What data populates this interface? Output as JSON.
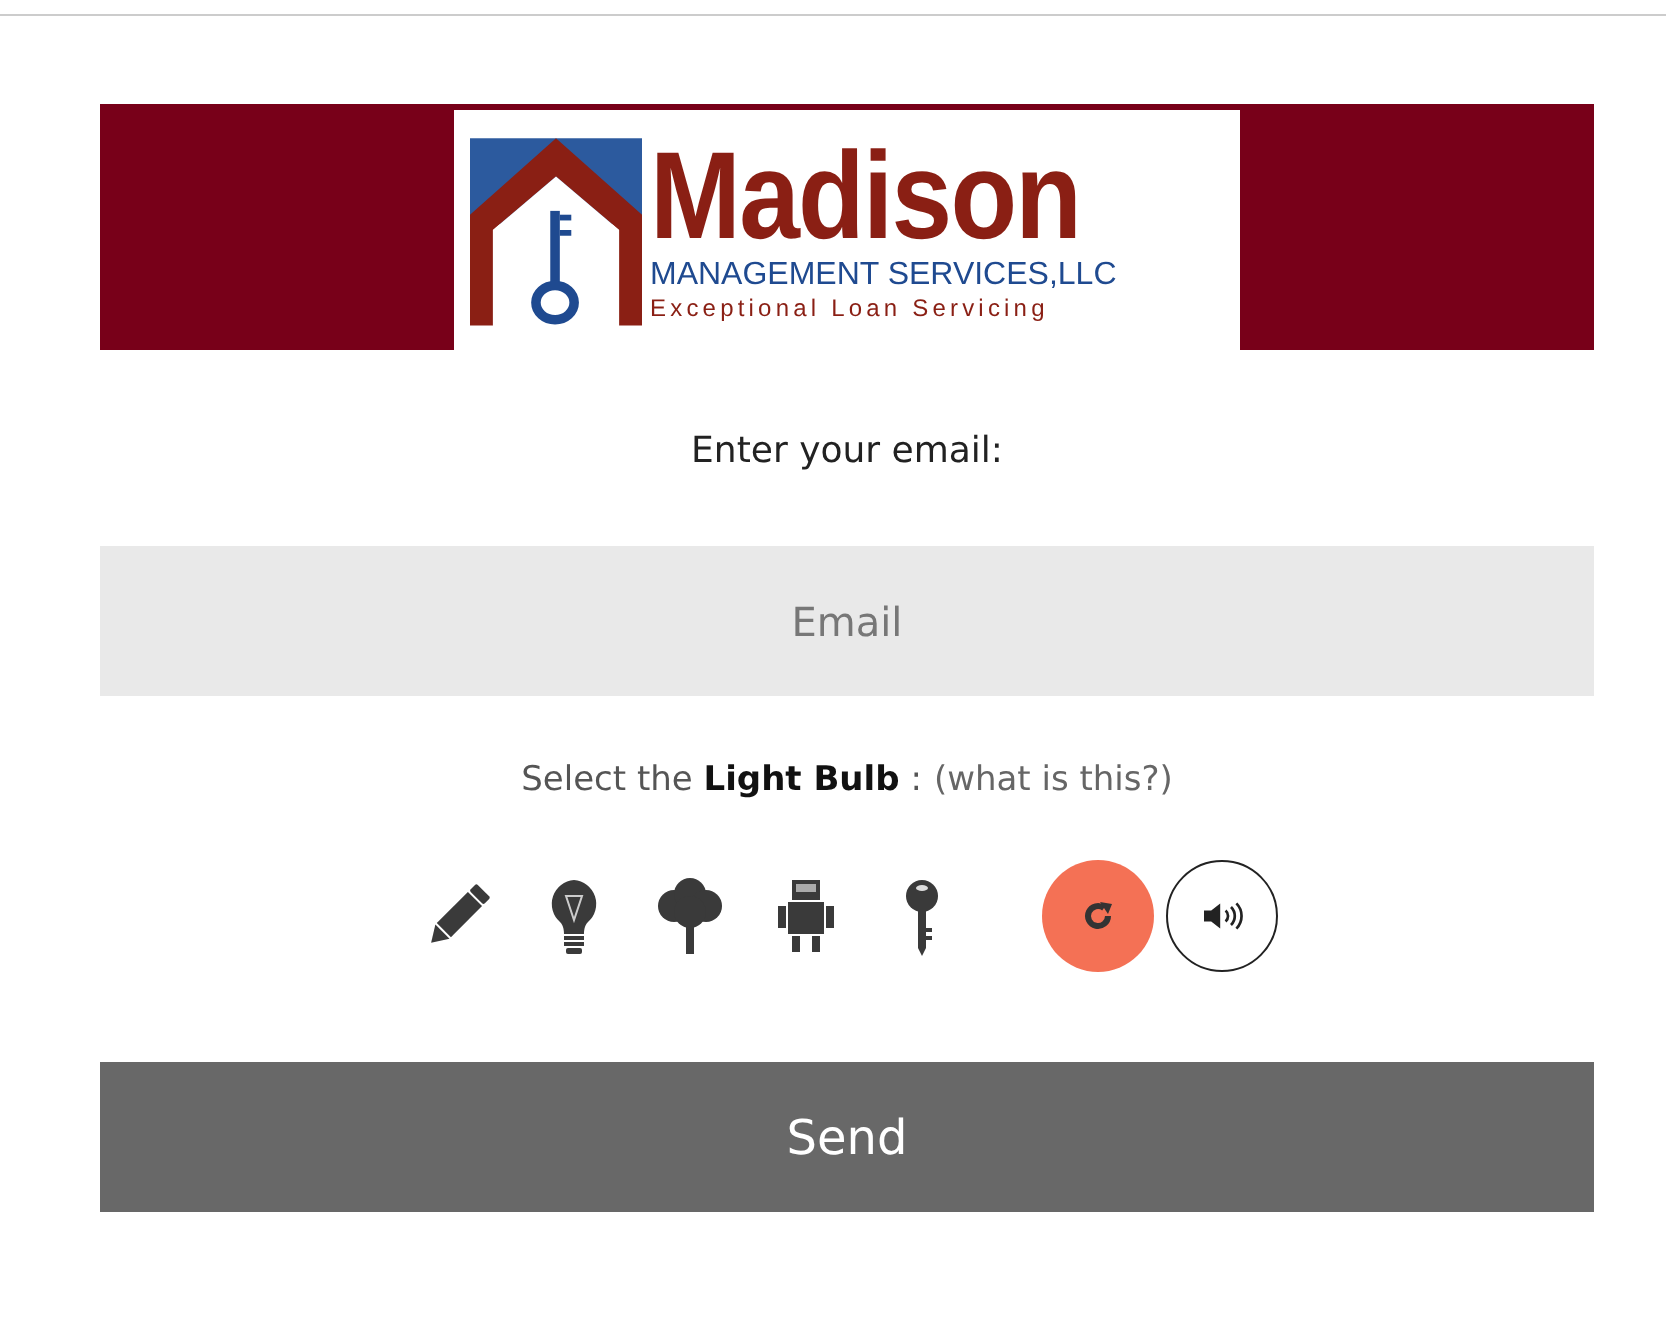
{
  "logo": {
    "name": "Madison",
    "subtitle": "MANAGEMENT SERVICES,LLC",
    "tagline": "Exceptional Loan Servicing"
  },
  "email_label": "Enter your email:",
  "email_field": {
    "placeholder": "Email"
  },
  "captcha": {
    "prompt": "Select the **Light Bulb** :",
    "help_link": "(what is this?)",
    "choices": [
      {
        "kind": "pencil",
        "selected": false
      },
      {
        "kind": "bulb",
        "selected": false
      },
      {
        "kind": "tree",
        "selected": false
      },
      {
        "kind": "robot",
        "selected": false
      },
      {
        "kind": "key",
        "selected": false
      }
    ]
  },
  "send_button": "Send"
}
